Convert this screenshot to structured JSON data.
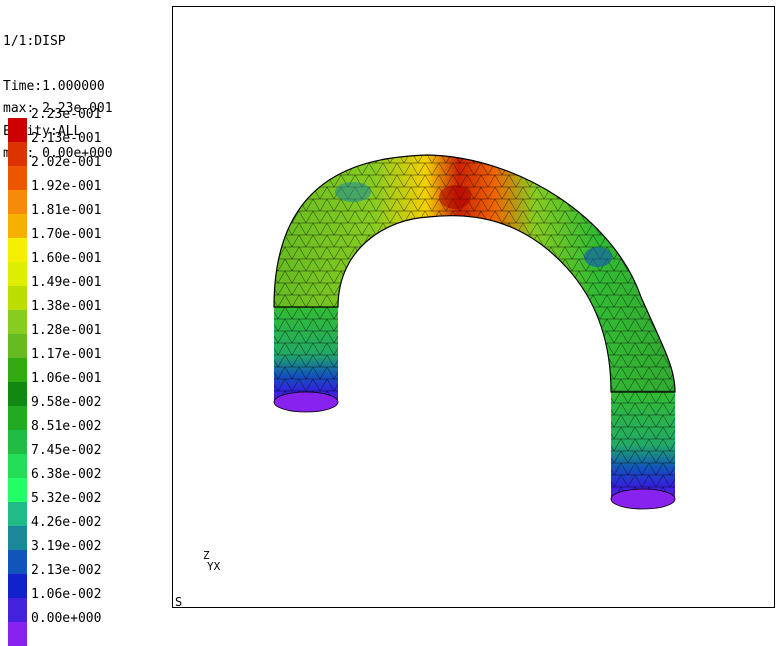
{
  "header": {
    "step": "1/1:DISP",
    "time": "Time:1.000000",
    "entity": "Entity:ALL"
  },
  "range": {
    "max": "max: 2.23e-001",
    "min": "min: 0.00e+000"
  },
  "legend": {
    "items": [
      {
        "label": "2.23e-001",
        "color": "#cc0000"
      },
      {
        "label": "2.13e-001",
        "color": "#dd3300"
      },
      {
        "label": "2.02e-001",
        "color": "#ee5500"
      },
      {
        "label": "1.92e-001",
        "color": "#f58a0a"
      },
      {
        "label": "1.81e-001",
        "color": "#f5b000"
      },
      {
        "label": "1.70e-001",
        "color": "#f5f000"
      },
      {
        "label": "1.60e-001",
        "color": "#ddee00"
      },
      {
        "label": "1.49e-001",
        "color": "#bbdd00"
      },
      {
        "label": "1.38e-001",
        "color": "#88cc22"
      },
      {
        "label": "1.28e-001",
        "color": "#66bb22"
      },
      {
        "label": "1.17e-001",
        "color": "#33aa11"
      },
      {
        "label": "1.06e-001",
        "color": "#118811"
      },
      {
        "label": "9.58e-002",
        "color": "#22aa22"
      },
      {
        "label": "8.51e-002",
        "color": "#22bb44"
      },
      {
        "label": "7.45e-002",
        "color": "#22dd55"
      },
      {
        "label": "6.38e-002",
        "color": "#22ff66"
      },
      {
        "label": "5.32e-002",
        "color": "#22bb88"
      },
      {
        "label": "4.26e-002",
        "color": "#1a8899"
      },
      {
        "label": "3.19e-002",
        "color": "#1155bb"
      },
      {
        "label": "2.13e-002",
        "color": "#1122cc"
      },
      {
        "label": "1.06e-002",
        "color": "#4422dd"
      },
      {
        "label": "0.00e+000",
        "color": "#8822ee"
      }
    ]
  },
  "triad": {
    "z": "Z",
    "xy": "YX"
  },
  "viewport": {
    "mode_letter": "S"
  }
}
